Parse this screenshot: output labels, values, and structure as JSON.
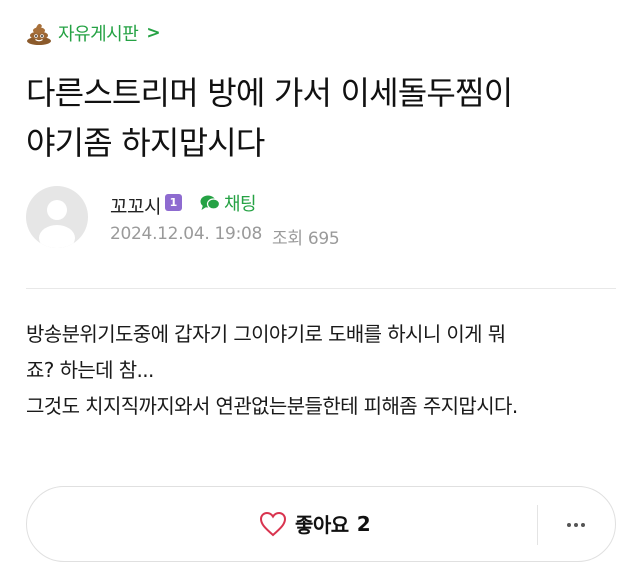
{
  "board": {
    "name": "자유게시판",
    "chevron": ">"
  },
  "post": {
    "title_line1": "다른스트리머 방에 가서 이세돌두찜이",
    "title_line2": "야기좀 하지맙시다",
    "author": "꼬꼬시",
    "level": "1",
    "chat_label": "채팅",
    "date": "2024.12.04. 19:08",
    "views_label": "조회",
    "views": "695",
    "body_lines": [
      "방송분위기도중에 갑자기 그이야기로 도배를 하시니 이게 뭐",
      "죠? 하는데 참...",
      "그것도 치지직까지와서 연관없는분들한테 피해좀 주지맙시다."
    ]
  },
  "actions": {
    "like_label": "좋아요",
    "like_count": "2"
  },
  "colors": {
    "accent": "#25a244",
    "badge": "#8e6bd0",
    "heart": "#d9344f"
  }
}
